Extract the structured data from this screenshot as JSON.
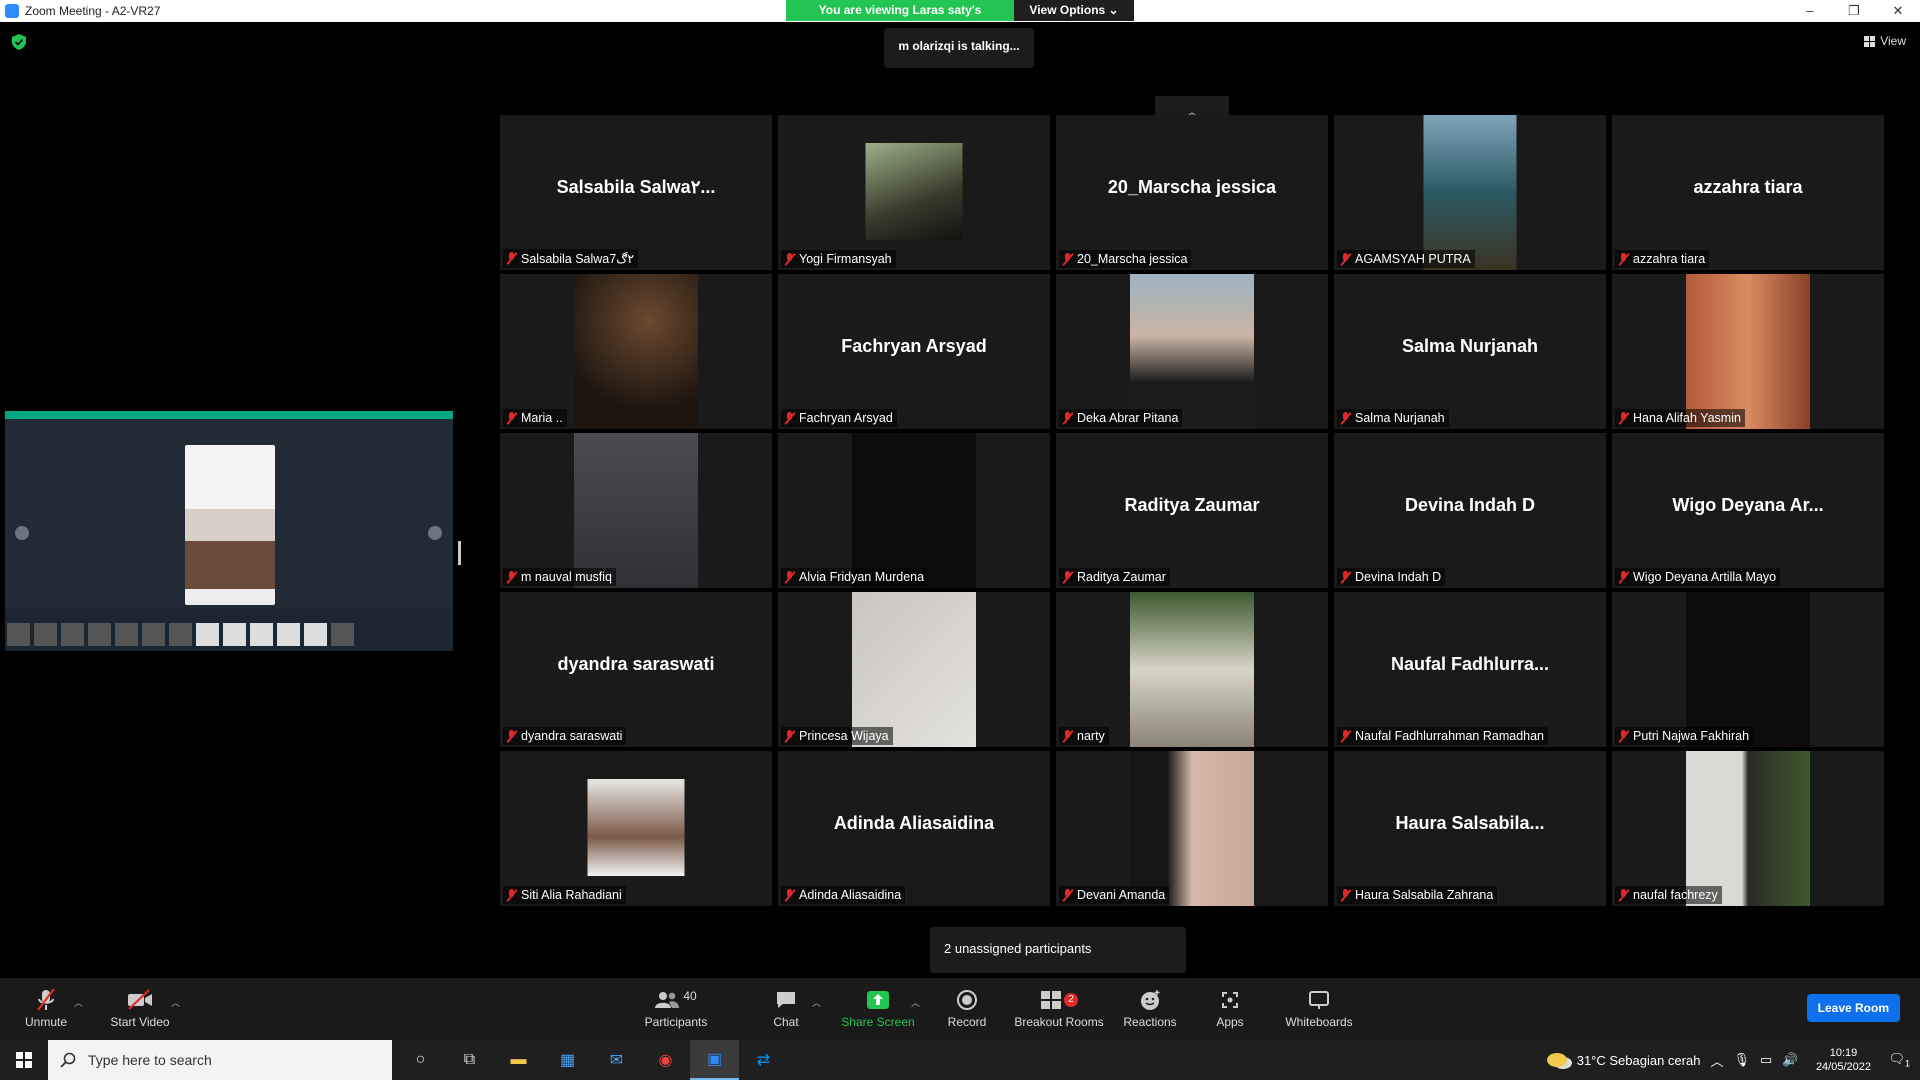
{
  "window": {
    "title": "Zoom Meeting - A2-VR27",
    "minimize": "–",
    "restore": "❐",
    "close": "✕"
  },
  "share_banner": {
    "viewing_text": "You are viewing Laras saty's screen",
    "view_options": "View Options ⌄"
  },
  "talking_indicator": "m olarizqi is talking...",
  "view_button": "View",
  "participants_grid": [
    {
      "big_name": "Salsabila Salwa٢...",
      "label": "Salsabila Salwa٢ڰ7",
      "video": false
    },
    {
      "big_name": "",
      "label": "Yogi Firmansyah",
      "video": true,
      "photo": "small"
    },
    {
      "big_name": "20_Marscha jessica",
      "label": "20_Marscha jessica",
      "video": false
    },
    {
      "big_name": "",
      "label": "AGAMSYAH PUTRA",
      "video": true,
      "photo": "tall"
    },
    {
      "big_name": "azzahra tiara",
      "label": "azzahra tiara",
      "video": false
    },
    {
      "big_name": "",
      "label": "Maria ..",
      "video": true,
      "photo": "dark"
    },
    {
      "big_name": "Fachryan Arsyad",
      "label": "Fachryan Arsyad",
      "video": false
    },
    {
      "big_name": "",
      "label": "Deka Abrar Pitana",
      "video": true,
      "photo": "person"
    },
    {
      "big_name": "Salma Nurjanah",
      "label": "Salma Nurjanah",
      "video": false
    },
    {
      "big_name": "",
      "label": "Hana Alifah Yasmin",
      "video": true,
      "photo": "brick"
    },
    {
      "big_name": "",
      "label": "m nauval musfiq",
      "video": true,
      "photo": "grey"
    },
    {
      "big_name": "",
      "label": "Alvia Fridyan Murdena",
      "video": true,
      "photo": "black"
    },
    {
      "big_name": "Raditya Zaumar",
      "label": "Raditya Zaumar",
      "video": false
    },
    {
      "big_name": "Devina Indah D",
      "label": "Devina Indah D",
      "video": false
    },
    {
      "big_name": "Wigo Deyana Ar...",
      "label": "Wigo Deyana Artilla Mayo",
      "video": false
    },
    {
      "big_name": "dyandra saraswati",
      "label": "dyandra saraswati",
      "video": false
    },
    {
      "big_name": "",
      "label": "Princesa Wijaya",
      "video": true,
      "photo": "light"
    },
    {
      "big_name": "",
      "label": "narty",
      "video": true,
      "photo": "outdoor"
    },
    {
      "big_name": "Naufal Fadhlurra...",
      "label": "Naufal Fadhlurrahman Ramadhan",
      "video": false
    },
    {
      "big_name": "",
      "label": "Putri Najwa Fakhirah",
      "video": true,
      "photo": "black"
    },
    {
      "big_name": "",
      "label": "Siti Alia Rahadiani",
      "video": true,
      "photo": "small-light"
    },
    {
      "big_name": "Adinda Aliasaidina",
      "label": "Adinda Aliasaidina",
      "video": false
    },
    {
      "big_name": "",
      "label": "Devani Amanda",
      "video": true,
      "photo": "face"
    },
    {
      "big_name": "Haura Salsabila...",
      "label": "Haura Salsabila Zahrana",
      "video": false
    },
    {
      "big_name": "",
      "label": "naufal fachrezy",
      "video": true,
      "photo": "plant"
    }
  ],
  "unassigned_text": "2 unassigned participants",
  "toolbar": {
    "unmute": "Unmute",
    "start_video": "Start Video",
    "participants": "Participants",
    "participants_count": "40",
    "chat": "Chat",
    "share_screen": "Share Screen",
    "record": "Record",
    "breakout_rooms": "Breakout Rooms",
    "breakout_badge": "2",
    "reactions": "Reactions",
    "apps": "Apps",
    "whiteboards": "Whiteboards",
    "leave": "Leave Room"
  },
  "taskbar": {
    "search_placeholder": "Type here to search",
    "weather": "31°C  Sebagian cerah",
    "time": "10:19",
    "date": "24/05/2022",
    "notification_count": "1"
  },
  "colors": {
    "accent_green": "#23c552",
    "leave_blue": "#0e71eb",
    "muted_red": "#e02828"
  }
}
